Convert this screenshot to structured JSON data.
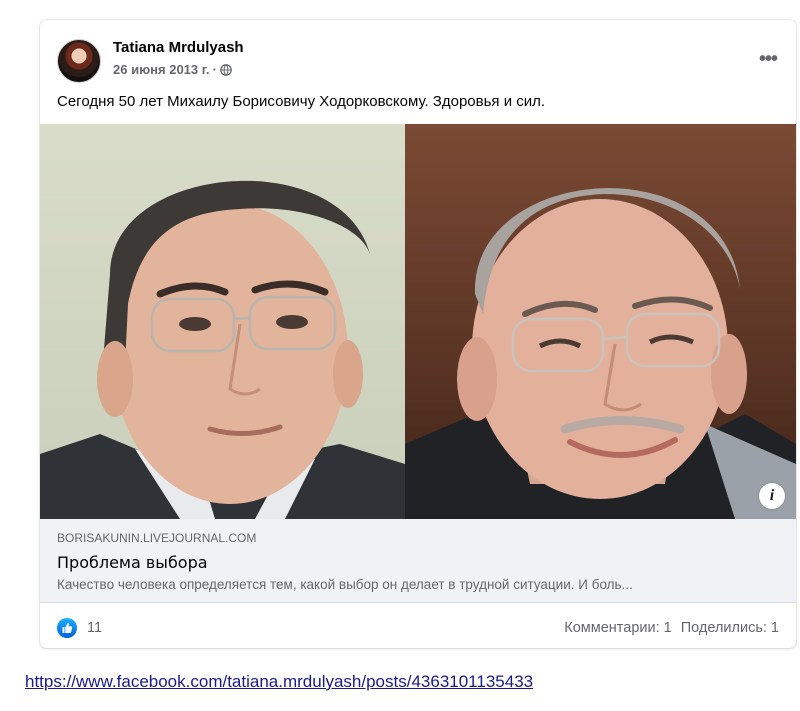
{
  "post": {
    "author": "Tatiana Mrdulyash",
    "date": "26 июня 2013 г.",
    "date_separator": "·",
    "text": "Сегодня 50 лет Михаилу Борисовичу Ходорковскому. Здоровья и сил."
  },
  "link_preview": {
    "domain": "BORISAKUNIN.LIVEJOURNAL.COM",
    "title": "Проблема выбора",
    "description": "Качество человека определяется тем, какой выбор он делает в трудной ситуации. И боль..."
  },
  "stats": {
    "likes": "11",
    "comments": "Комментарии: 1",
    "shares": "Поделились: 1"
  },
  "icons": {
    "more": "more-options-icon",
    "privacy": "globe-icon",
    "info": "info-icon",
    "like": "like-reaction-icon"
  },
  "info_glyph": "i",
  "source_url": "https://www.facebook.com/tatiana.mrdulyash/posts/4363101135433",
  "colors": {
    "facebook_blue": "#1877f2",
    "secondary_text": "#65676b",
    "link_preview_bg": "#f0f2f5"
  }
}
